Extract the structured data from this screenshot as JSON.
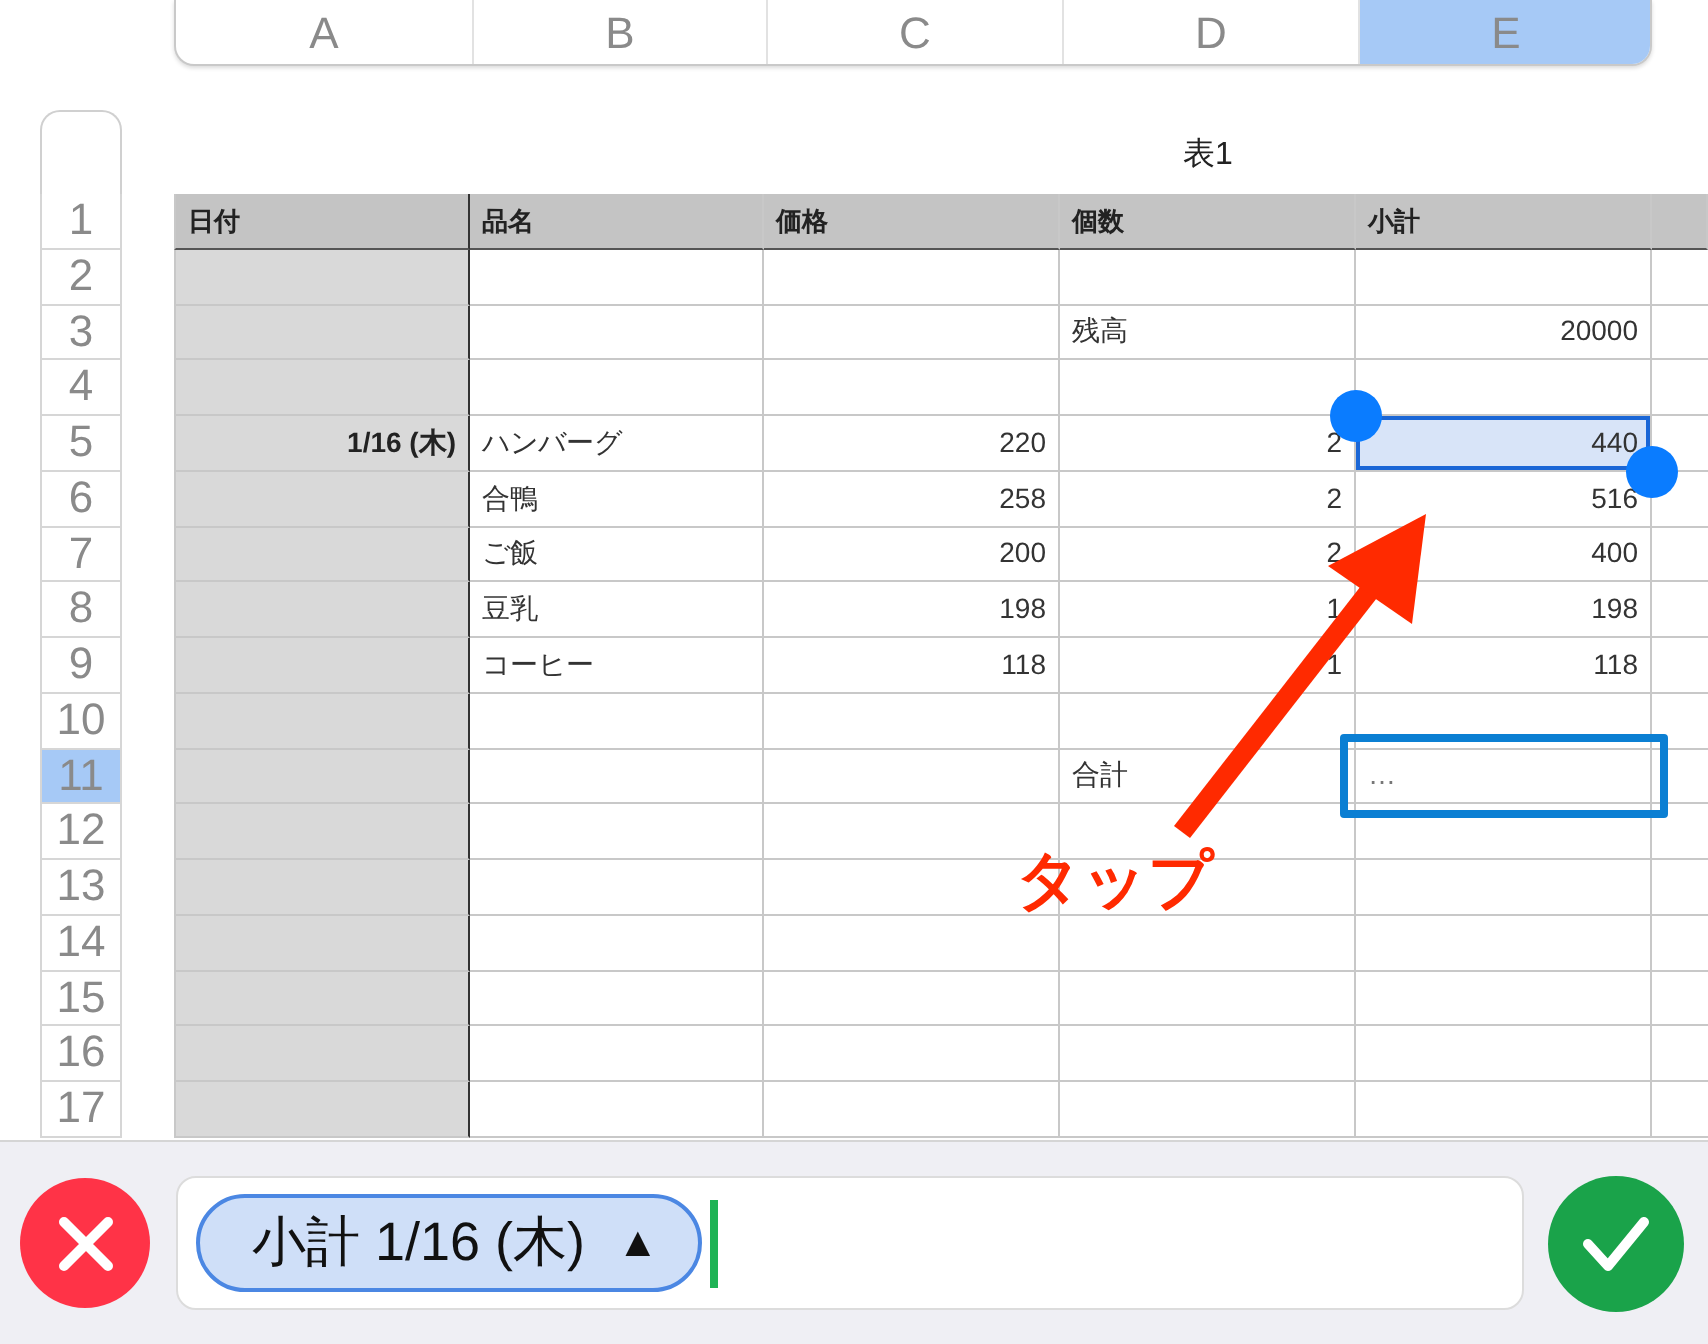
{
  "column_headers": [
    {
      "label": "A",
      "selected": false
    },
    {
      "label": "B",
      "selected": false
    },
    {
      "label": "C",
      "selected": false
    },
    {
      "label": "D",
      "selected": false
    },
    {
      "label": "E",
      "selected": true
    }
  ],
  "row_headers": [
    {
      "label": "1",
      "selected": false
    },
    {
      "label": "2",
      "selected": false
    },
    {
      "label": "3",
      "selected": false
    },
    {
      "label": "4",
      "selected": false
    },
    {
      "label": "5",
      "selected": false
    },
    {
      "label": "6",
      "selected": false
    },
    {
      "label": "7",
      "selected": false
    },
    {
      "label": "8",
      "selected": false
    },
    {
      "label": "9",
      "selected": false
    },
    {
      "label": "10",
      "selected": false
    },
    {
      "label": "11",
      "selected": true
    },
    {
      "label": "12",
      "selected": false
    },
    {
      "label": "13",
      "selected": false
    },
    {
      "label": "14",
      "selected": false
    },
    {
      "label": "15",
      "selected": false
    },
    {
      "label": "16",
      "selected": false
    },
    {
      "label": "17",
      "selected": false
    }
  ],
  "table": {
    "title": "表1",
    "columns": [
      "日付",
      "品名",
      "価格",
      "個数",
      "小計"
    ],
    "rows": [
      {
        "selected": false,
        "editing": false
      },
      {
        "quantity": "残高",
        "subtotal": "20000",
        "selected": false,
        "editing": false
      },
      {
        "selected": false,
        "editing": false
      },
      {
        "date": "1/16 (木)",
        "item": "ハンバーグ",
        "price": "220",
        "quantity": "2",
        "subtotal": "440",
        "selected": true,
        "editing": false
      },
      {
        "item": "合鴨",
        "price": "258",
        "quantity": "2",
        "subtotal": "516",
        "selected": false,
        "editing": false
      },
      {
        "item": "ご飯",
        "price": "200",
        "quantity": "2",
        "subtotal": "400",
        "selected": false,
        "editing": false
      },
      {
        "item": "豆乳",
        "price": "198",
        "quantity": "1",
        "subtotal": "198",
        "selected": false,
        "editing": false
      },
      {
        "item": "コーヒー",
        "price": "118",
        "quantity": "1",
        "subtotal": "118",
        "selected": false,
        "editing": false
      },
      {
        "selected": false,
        "editing": false
      },
      {
        "quantity": "合計",
        "subtotal": "…",
        "selected": false,
        "editing": true
      },
      {
        "selected": false,
        "editing": false
      },
      {
        "selected": false,
        "editing": false
      },
      {
        "selected": false,
        "editing": false
      },
      {
        "selected": false,
        "editing": false
      },
      {
        "selected": false,
        "editing": false
      },
      {
        "selected": false,
        "editing": false
      }
    ]
  },
  "formula_bar": {
    "token": "小計 1/16 (木)",
    "token_caret": "▲"
  },
  "annotation": {
    "label": "タップ"
  }
}
